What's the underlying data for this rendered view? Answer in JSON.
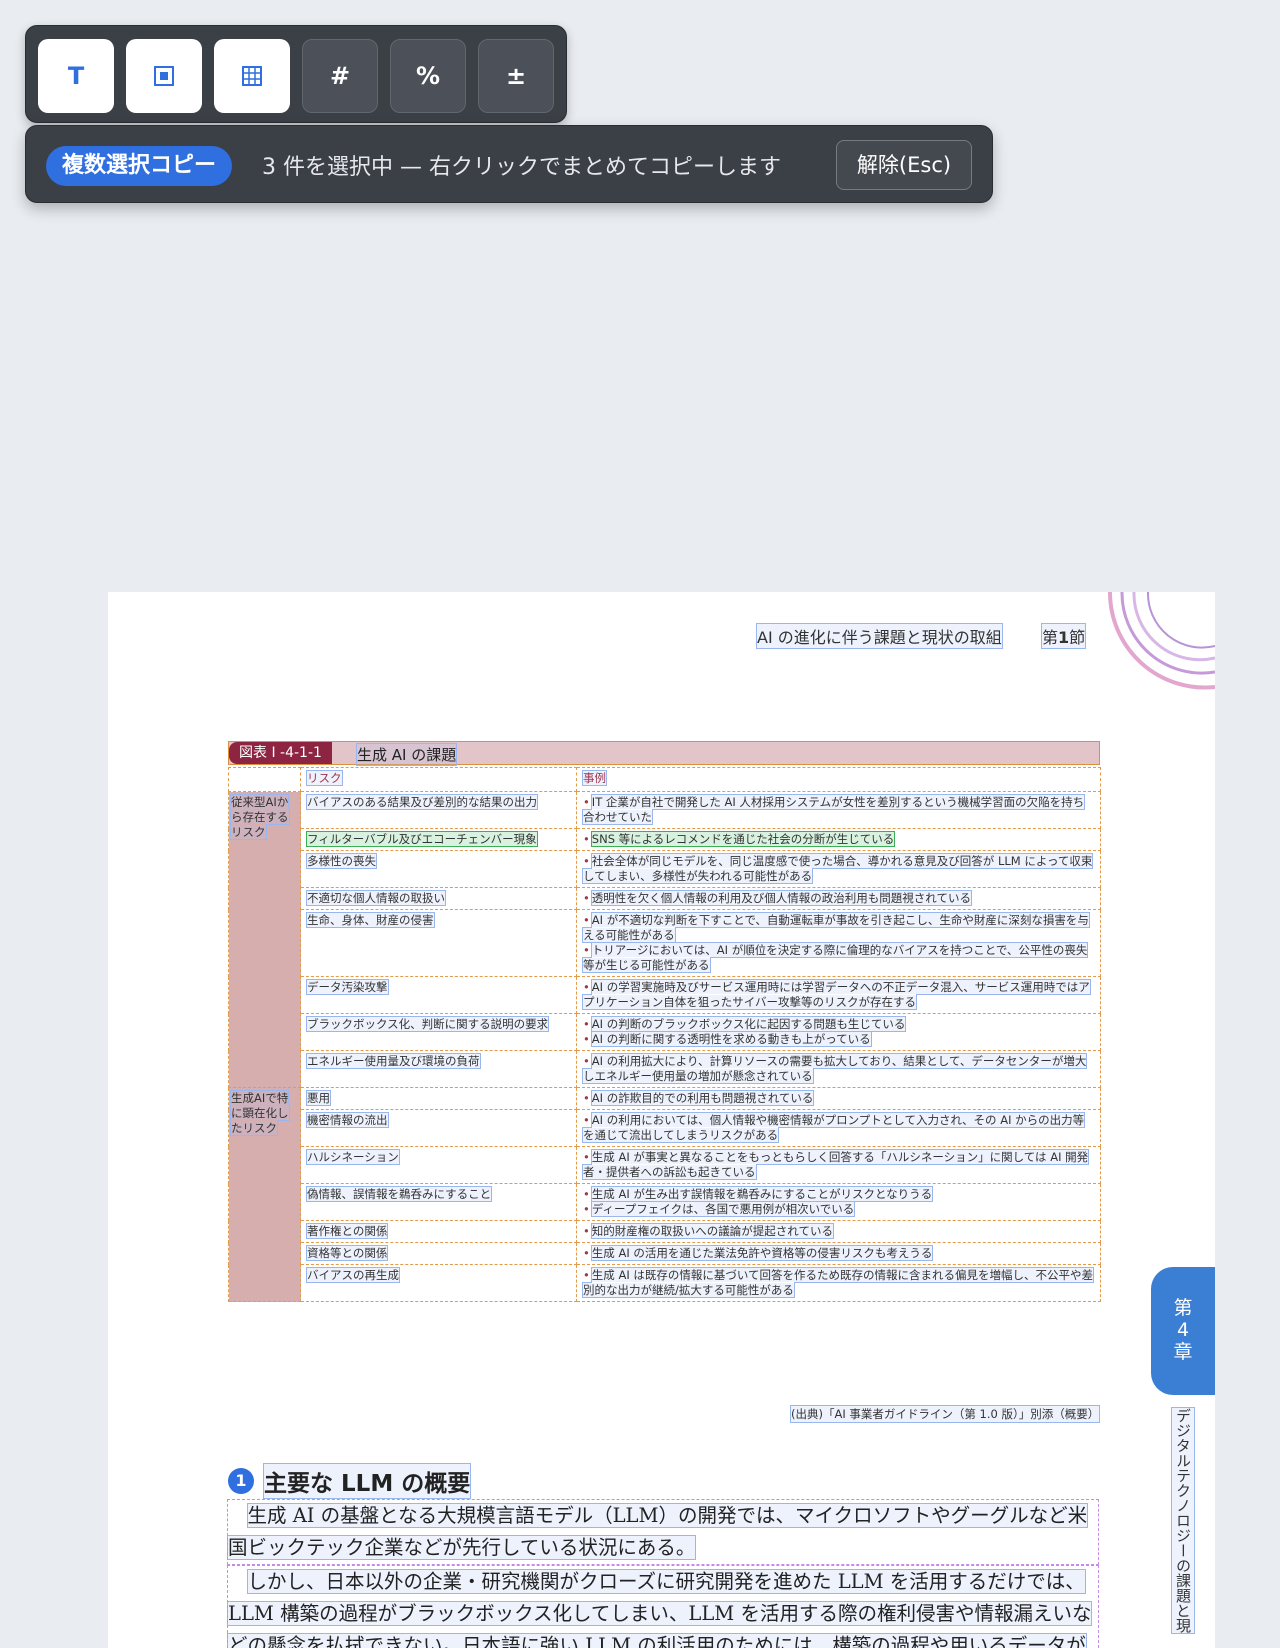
{
  "toolbar": {
    "tools": [
      {
        "name": "text-mode",
        "glyph": "T",
        "active": true
      },
      {
        "name": "box-mode",
        "glyph": "",
        "active": true
      },
      {
        "name": "table-mode",
        "glyph": "",
        "active": true
      },
      {
        "name": "number-mode",
        "glyph": "#",
        "active": false
      },
      {
        "name": "percent-mode",
        "glyph": "%",
        "active": false
      },
      {
        "name": "plusminus-mode",
        "glyph": "±",
        "active": false
      }
    ]
  },
  "selection_bar": {
    "mode_label": "複数選択コピー",
    "status": "3 件を選択中 — 右クリックでまとめてコピーします",
    "clear_label": "解除(Esc)"
  },
  "page": {
    "header_title": "AI の進化に伴う課題と現状の取組",
    "section_prefix": "第",
    "section_number": "1",
    "section_suffix": "節",
    "figure_label": "図表 I -4-1-1",
    "figure_title": "生成 AI の課題",
    "table": {
      "col_risk": "リスク",
      "col_case": "事例",
      "groups": [
        {
          "label": "従来型AIから存在するリスク",
          "rows": [
            {
              "risk": "バイアスのある結果及び差別的な結果の出力",
              "cases": [
                "IT 企業が自社で開発した AI 人材採用システムが女性を差別するという機械学習面の欠陥を持ち合わせていた"
              ]
            },
            {
              "risk": "フィルターバブル及びエコーチェンバー現象",
              "cases": [
                "SNS 等によるレコメンドを通じた社会の分断が生じている"
              ]
            },
            {
              "risk": "多様性の喪失",
              "cases": [
                "社会全体が同じモデルを、同じ温度感で使った場合、導かれる意見及び回答が LLM によって収束してしまい、多様性が失われる可能性がある"
              ]
            },
            {
              "risk": "不適切な個人情報の取扱い",
              "cases": [
                "透明性を欠く個人情報の利用及び個人情報の政治利用も問題視されている"
              ]
            },
            {
              "risk": "生命、身体、財産の侵害",
              "cases": [
                "AI が不適切な判断を下すことで、自動運転車が事故を引き起こし、生命や財産に深刻な損害を与える可能性がある",
                "トリアージにおいては、AI が順位を決定する際に倫理的なバイアスを持つことで、公平性の喪失等が生じる可能性がある"
              ]
            },
            {
              "risk": "データ汚染攻撃",
              "cases": [
                "AI の学習実施時及びサービス運用時には学習データへの不正データ混入、サービス運用時ではアプリケーション自体を狙ったサイバー攻撃等のリスクが存在する"
              ]
            },
            {
              "risk": "ブラックボックス化、判断に関する説明の要求",
              "cases": [
                "AI の判断のブラックボックス化に起因する問題も生じている",
                "AI の判断に関する透明性を求める動きも上がっている"
              ]
            },
            {
              "risk": "エネルギー使用量及び環境の負荷",
              "cases": [
                "AI の利用拡大により、計算リソースの需要も拡大しており、結果として、データセンターが増大しエネルギー使用量の増加が懸念されている"
              ]
            }
          ]
        },
        {
          "label": "生成AIで特に顕在化したリスク",
          "rows": [
            {
              "risk": "悪用",
              "cases": [
                "AI の詐欺目的での利用も問題視されている"
              ]
            },
            {
              "risk": "機密情報の流出",
              "cases": [
                "AI の利用においては、個人情報や機密情報がプロンプトとして入力され、その AI からの出力等を通じて流出してしまうリスクがある"
              ]
            },
            {
              "risk": "ハルシネーション",
              "cases": [
                "生成 AI が事実と異なることをもっともらしく回答する「ハルシネーション」に関しては AI 開発者・提供者への訴訟も起きている"
              ]
            },
            {
              "risk": "偽情報、誤情報を鵜呑みにすること",
              "cases": [
                "生成 AI が生み出す誤情報を鵜呑みにすることがリスクとなりうる",
                "ディープフェイクは、各国で悪用例が相次いでいる"
              ]
            },
            {
              "risk": "著作権との関係",
              "cases": [
                "知的財産権の取扱いへの議論が提起されている"
              ]
            },
            {
              "risk": "資格等との関係",
              "cases": [
                "生成 AI の活用を通じた業法免許や資格等の侵害リスクも考えうる"
              ]
            },
            {
              "risk": "バイアスの再生成",
              "cases": [
                "生成 AI は既存の情報に基づいて回答を作るため既存の情報に含まれる偏見を増幅し、不公平や差別的な出力が継続/拡大する可能性がある"
              ]
            }
          ]
        }
      ]
    },
    "source": "(出典)「AI 事業者ガイドライン（第 1.0 版）」別添（概要）",
    "section_heading_number": "1",
    "section_heading": "主要な LLM の概要",
    "paragraph1": "生成 AI の基盤となる大規模言語モデル（LLM）の開発では、マイクロソフトやグーグルなど米国ビックテック企業などが先行している状況にある。",
    "paragraph2": "しかし、日本以外の企業・研究機関がクローズに研究開発を進めた LLM を活用するだけでは、LLM 構築の過程がブラックボックス化してしまい、LLM を活用する際の権利侵害や情報漏えいなどの懸念を払拭できない。日本語に強い LLM の利活用のためには、構築の過程や用いるデータが",
    "chapter_tab_prefix": "第",
    "chapter_tab_number": "4",
    "chapter_tab_suffix": "章",
    "side_title": "デジタルテクノロジーの課題と現"
  }
}
